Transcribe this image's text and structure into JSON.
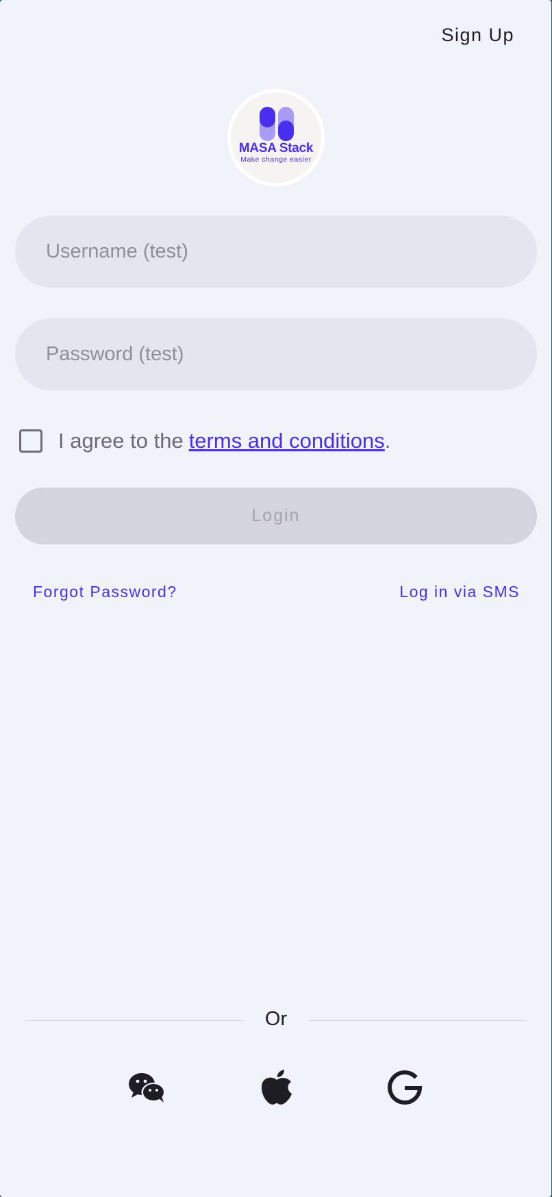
{
  "header": {
    "signup_label": "Sign Up"
  },
  "logo": {
    "name": "MASA Stack",
    "tagline": "Make change easier",
    "brand_color": "#4a2ef0",
    "brand_color_light": "#a89cf7"
  },
  "form": {
    "username_placeholder": "Username (test)",
    "username_value": "",
    "password_placeholder": "Password (test)",
    "password_value": "",
    "agree_checked": false,
    "agree_prefix": "I agree to the",
    "terms_link": "terms and conditions ",
    "agree_suffix": ".",
    "login_label": "Login",
    "login_enabled": false
  },
  "links": {
    "forgot_password": "Forgot Password?",
    "sms_login": "Log in via SMS"
  },
  "divider": {
    "label": "Or"
  },
  "social": [
    {
      "icon": "wechat-icon"
    },
    {
      "icon": "apple-icon"
    },
    {
      "icon": "google-icon"
    }
  ],
  "colors": {
    "background": "#f0f3fa",
    "field_bg": "#e3e6ee",
    "button_disabled_bg": "#d2d5dd",
    "accent": "#4a2ef0"
  }
}
